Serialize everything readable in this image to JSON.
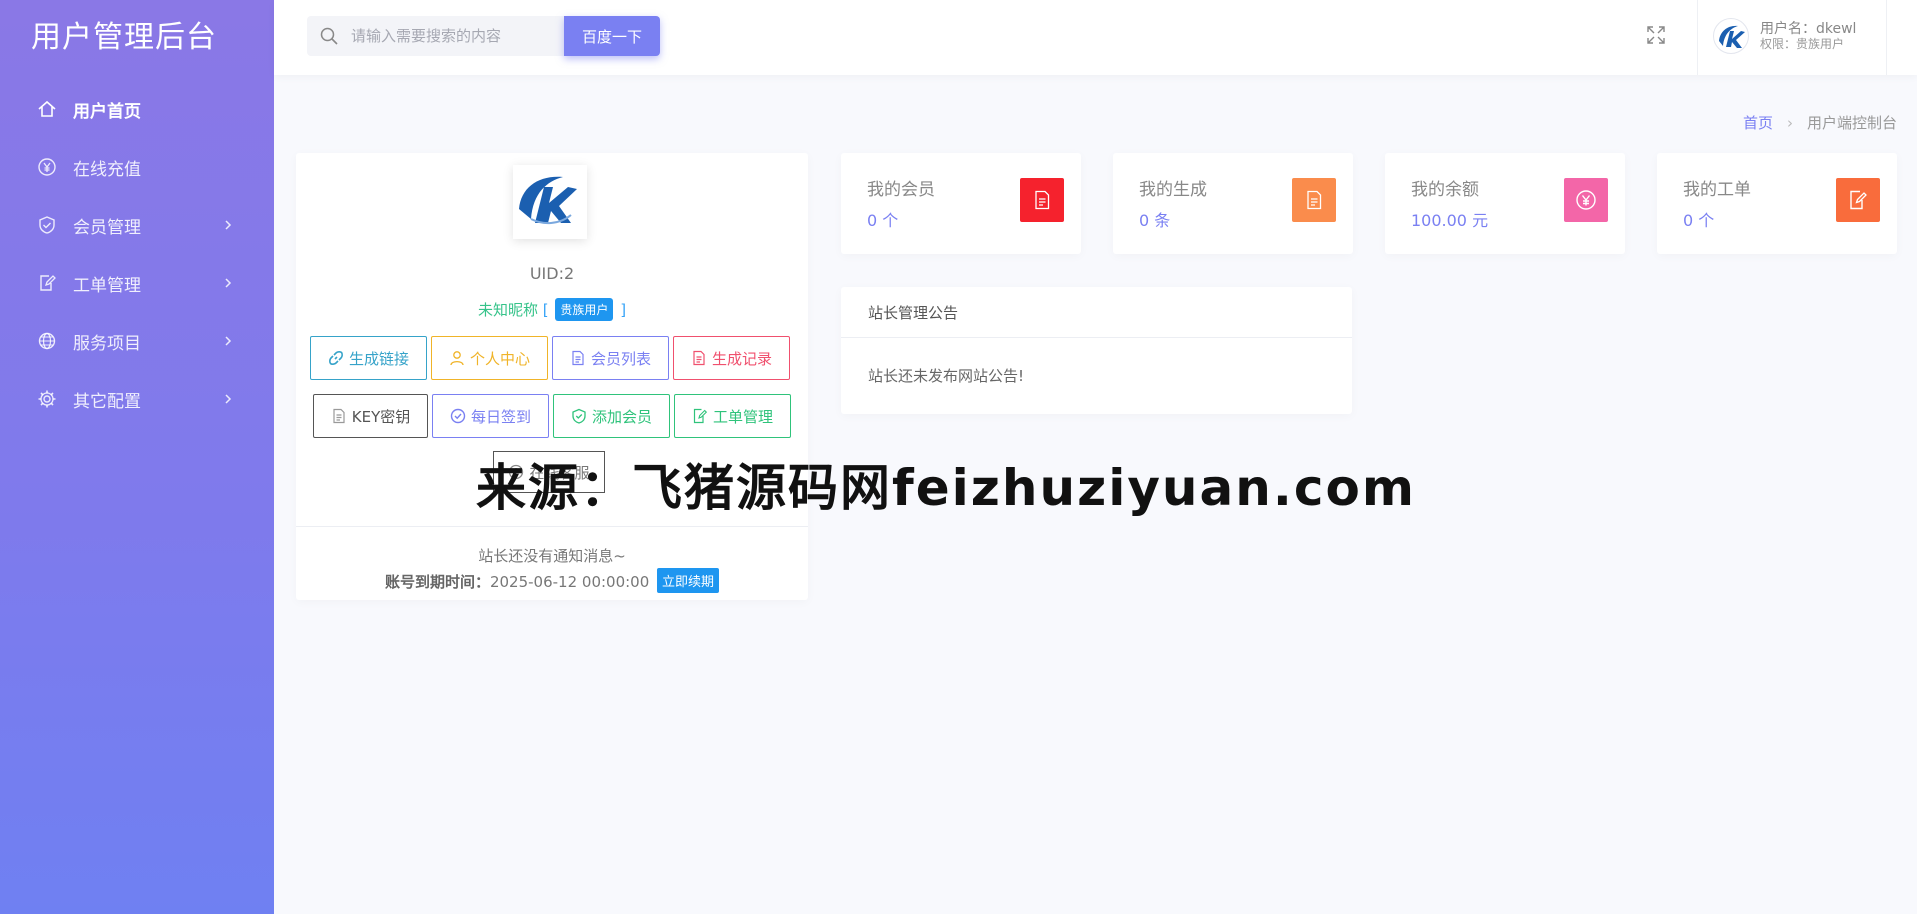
{
  "sidebar": {
    "title": "用户管理后台",
    "items": [
      {
        "label": "用户首页",
        "icon": "home-icon",
        "active": true,
        "has_children": false
      },
      {
        "label": "在线充值",
        "icon": "yen-circle-icon",
        "active": false,
        "has_children": false
      },
      {
        "label": "会员管理",
        "icon": "shield-check-icon",
        "active": false,
        "has_children": true
      },
      {
        "label": "工单管理",
        "icon": "edit-doc-icon",
        "active": false,
        "has_children": true
      },
      {
        "label": "服务项目",
        "icon": "globe-icon",
        "active": false,
        "has_children": true
      },
      {
        "label": "其它配置",
        "icon": "gear-icon",
        "active": false,
        "has_children": true
      }
    ]
  },
  "header": {
    "search": {
      "placeholder": "请输入需要搜索的内容",
      "value": "",
      "button_label": "百度一下"
    },
    "user": {
      "name_label": "用户名：dkewl",
      "role_label": "权限：贵族用户"
    }
  },
  "breadcrumb": {
    "home": "首页",
    "current": "用户端控制台"
  },
  "profile": {
    "uid": "UID:2",
    "nickname": "未知昵称",
    "bracket_open": "[",
    "bracket_close": "]",
    "vip_tag": "贵族用户",
    "buttons_row1": [
      {
        "label": "生成链接",
        "icon": "link-icon"
      },
      {
        "label": "个人中心",
        "icon": "user-icon"
      },
      {
        "label": "会员列表",
        "icon": "doc-icon"
      },
      {
        "label": "生成记录",
        "icon": "doc-icon"
      }
    ],
    "buttons_row2": [
      {
        "label": "KEY密钥",
        "icon": "doc-icon"
      },
      {
        "label": "每日签到",
        "icon": "check-circle-icon"
      },
      {
        "label": "添加会员",
        "icon": "shield-check-icon"
      },
      {
        "label": "工单管理",
        "icon": "edit-doc-icon"
      }
    ],
    "online_button": "在线客服",
    "notice": "站长还没有通知消息~",
    "expiry_label": "账号到期时间：",
    "expiry_value": "2025-06-12 00:00:00",
    "renew_label": "立即续期"
  },
  "stats": [
    {
      "label": "我的会员",
      "value": "0 个",
      "color": "#f5222d",
      "icon": "doc-icon"
    },
    {
      "label": "我的生成",
      "value": "0 条",
      "color": "#fa8c4c",
      "icon": "doc-icon"
    },
    {
      "label": "我的余额",
      "value": "100.00 元",
      "color": "#f366a8",
      "icon": "yen-circle-icon"
    },
    {
      "label": "我的工单",
      "value": "0 个",
      "color": "#f96c3c",
      "icon": "edit-doc-icon"
    }
  ],
  "announcement": {
    "title": "站长管理公告",
    "body": "站长还未发布网站公告!"
  },
  "watermark": "来源：飞猪源码网feizhuziyuan.com"
}
